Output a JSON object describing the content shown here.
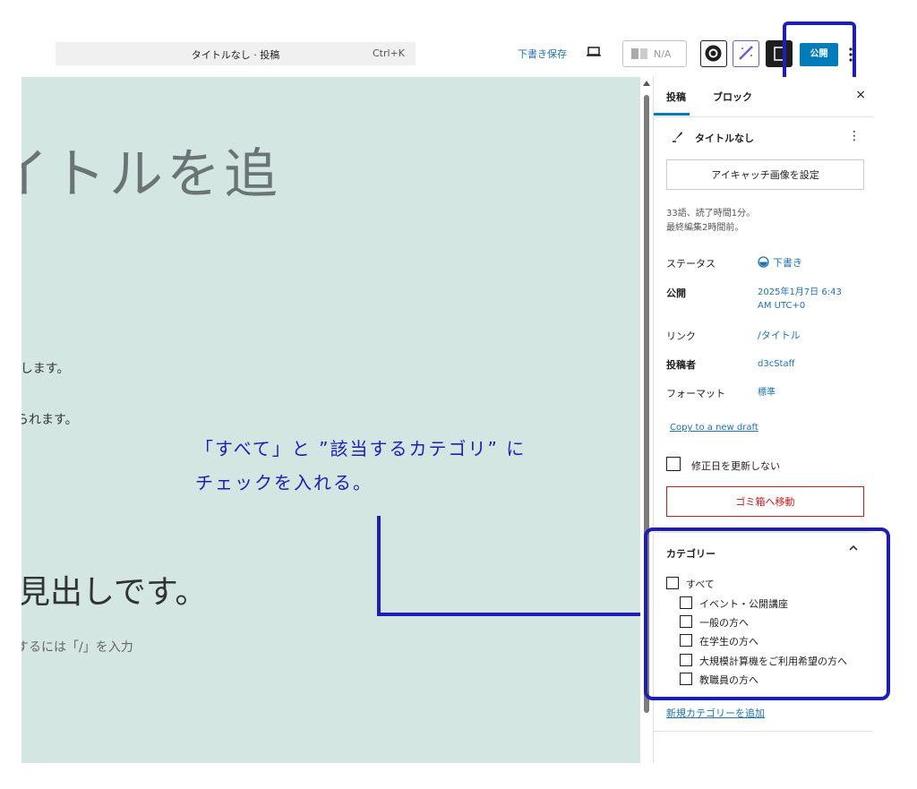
{
  "header": {
    "command_title": "タイトルなし · 投稿",
    "command_shortcut": "Ctrl+K",
    "save_draft": "下書き保存",
    "jetpack_label": "N/A",
    "publish": "公開"
  },
  "editor": {
    "title_fragment": "イトルを追",
    "paragraph1": "ιします。",
    "paragraph2": "られます。",
    "heading": "見出しです。",
    "placeholder": "するには「/」を入力"
  },
  "annotation": {
    "line1": "「すべて」と ”該当するカテゴリ” に",
    "line2": "チェックを入れる。"
  },
  "sidebar": {
    "tab_post": "投稿",
    "tab_block": "ブロック",
    "close": "×",
    "post_title": "タイトルなし",
    "featured_image": "アイキャッチ画像を設定",
    "meta_words": "33語、読了時間1分。",
    "meta_edited": "最終編集2時間前。",
    "status_label": "ステータス",
    "status_value": "下書き",
    "publish_label": "公開",
    "publish_value_1": "2025年1月7日 6:43",
    "publish_value_2": "AM UTC+0",
    "link_label": "リンク",
    "link_value": "/タイトル",
    "author_label": "投稿者",
    "author_value": "d3cStaff",
    "format_label": "フォーマット",
    "format_value": "標準",
    "copy_draft": "Copy to a new draft",
    "no_update_date": "修正日を更新しない",
    "trash": "ゴミ箱へ移動",
    "categories_title": "カテゴリー",
    "categories": [
      {
        "label": "すべて",
        "level": 0
      },
      {
        "label": "イベント・公開講座",
        "level": 1
      },
      {
        "label": "一般の方へ",
        "level": 1
      },
      {
        "label": "在学生の方へ",
        "level": 1
      },
      {
        "label": "大規模計算機をご利用希望の方へ",
        "level": 1
      },
      {
        "label": "教職員の方へ",
        "level": 1
      }
    ],
    "add_category": "新規カテゴリーを追加"
  },
  "colors": {
    "canvas_bg": "#d4e6e1",
    "accent": "#007cba",
    "annotation": "#1e1eb4",
    "danger": "#cc1818"
  }
}
